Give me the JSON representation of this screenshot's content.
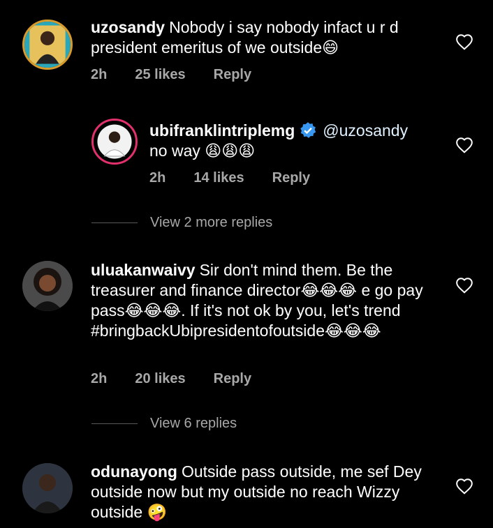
{
  "comments": [
    {
      "username": "uzosandy",
      "text": "Nobody i say nobody infact u r d president emeritus of we outside😄",
      "time": "2h",
      "likes": "25 likes",
      "reply": "Reply"
    },
    {
      "username": "ubifranklintriplemg",
      "mention": "@uzosandy",
      "text": "no way 😩😩😩",
      "time": "2h",
      "likes": "14 likes",
      "reply": "Reply",
      "verified": true
    },
    {
      "username": "uluakanwaivy",
      "text": "Sir don't mind them. Be the treasurer and finance director😂😂😂 e go pay pass😂😂😂. If it's not ok by you, let's trend #bringbackUbipresidentofoutside😂😂😂",
      "time": "2h",
      "likes": "20 likes",
      "reply": "Reply"
    },
    {
      "username": "odunayong",
      "text": "Outside pass outside, me sef Dey outside now but my outside no reach Wizzy outside 🤪"
    }
  ],
  "view_replies": [
    {
      "label": "View 2 more replies"
    },
    {
      "label": "View 6 replies"
    }
  ],
  "colors": {
    "background": "#000000",
    "meta_text": "#a8a8a8",
    "verified_badge": "#3897f0",
    "story_ring": "#e1306c"
  },
  "icons": {
    "like": "heart-outline-icon",
    "verified": "verified-badge-icon"
  }
}
